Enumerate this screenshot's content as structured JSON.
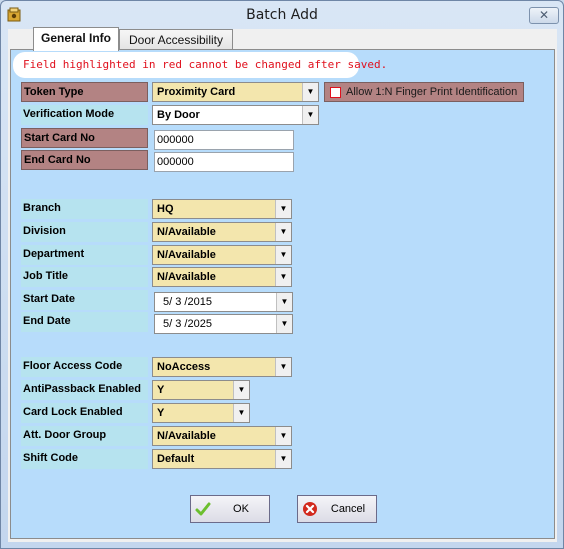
{
  "window": {
    "title": "Batch Add",
    "close_glyph": "✕"
  },
  "tabs": [
    {
      "label": "General Info",
      "active": true
    },
    {
      "label": "Door Accessibility",
      "active": false
    }
  ],
  "notice": "Field highlighted in red cannot be changed after saved.",
  "fields": {
    "token_type": {
      "label": "Token Type",
      "value": "Proximity Card"
    },
    "verification_mode": {
      "label": "Verification Mode",
      "value": "By Door"
    },
    "start_card_no": {
      "label": "Start Card No",
      "value": "000000"
    },
    "end_card_no": {
      "label": "End Card No",
      "value": "000000"
    },
    "branch": {
      "label": "Branch",
      "value": "HQ"
    },
    "division": {
      "label": "Division",
      "value": "N/Available"
    },
    "department": {
      "label": "Department",
      "value": "N/Available"
    },
    "job_title": {
      "label": "Job Title",
      "value": "N/Available"
    },
    "start_date": {
      "label": "Start Date",
      "value": "5/ 3 /2015"
    },
    "end_date": {
      "label": "End Date",
      "value": "5/ 3 /2025"
    },
    "floor_access_code": {
      "label": "Floor Access Code",
      "value": "NoAccess"
    },
    "antipassback": {
      "label": "AntiPassback Enabled",
      "value": "Y"
    },
    "card_lock": {
      "label": "Card Lock Enabled",
      "value": "Y"
    },
    "att_door_group": {
      "label": "Att. Door Group",
      "value": "N/Available"
    },
    "shift_code": {
      "label": "Shift Code",
      "value": "Default"
    }
  },
  "checkbox": {
    "label": "Allow 1:N Finger Print Identification",
    "checked": false
  },
  "buttons": {
    "ok_label": "OK",
    "cancel_label": "Cancel"
  },
  "colors": {
    "panel_bg": "#b7dcfb",
    "label_bg": "#b6e3ef",
    "locked_label_bg": "#b38383",
    "select_bg": "#f3e6ad",
    "notice_text": "#e0101d",
    "ok_icon": "#6cbf2f",
    "cancel_icon": "#d22a1e"
  },
  "icons": {
    "app": "app-icon",
    "dropdown": "chevron-down-icon",
    "ok": "check-icon",
    "cancel": "cancel-icon"
  }
}
